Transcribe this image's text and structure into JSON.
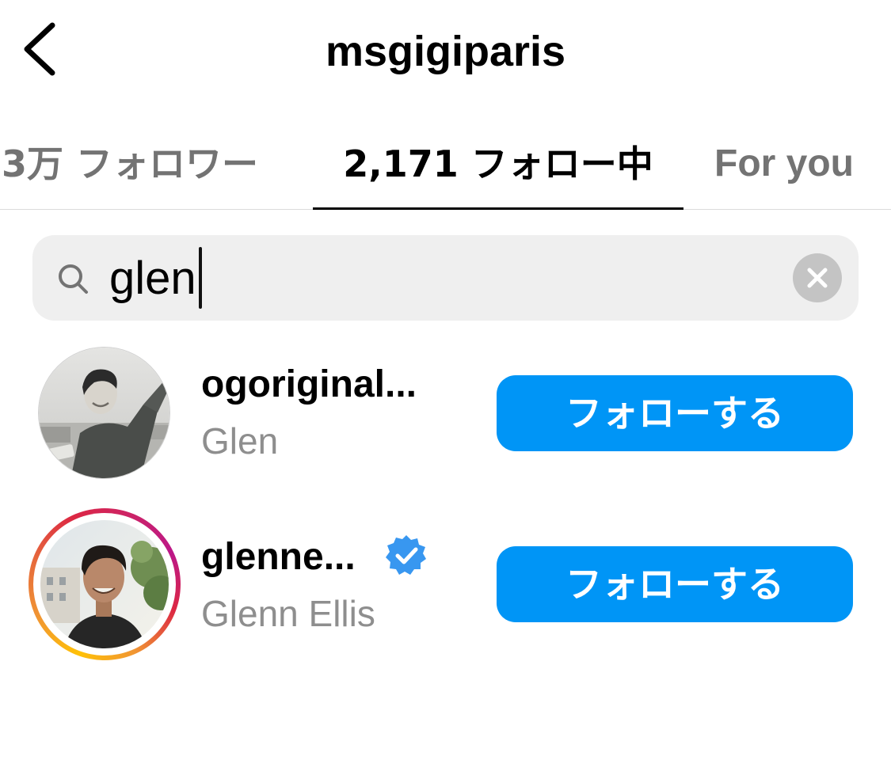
{
  "header": {
    "title": "msgigiparis",
    "back_icon": "chevron-left-icon"
  },
  "tabs": [
    {
      "label": "3万 フォロワー",
      "active": false
    },
    {
      "label": "2,171 フォロー中",
      "active": true
    },
    {
      "label": "For you",
      "active": false
    }
  ],
  "search": {
    "value": "glen",
    "search_icon": "search-icon",
    "clear_icon": "clear-icon"
  },
  "results": [
    {
      "username": "ogoriginal...",
      "full_name": "Glen",
      "verified": false,
      "has_story": false,
      "button_label": "フォローする"
    },
    {
      "username": "glenne...",
      "full_name": "Glenn Ellis",
      "verified": true,
      "has_story": true,
      "button_label": "フォローする"
    }
  ],
  "colors": {
    "accent": "#0095f6",
    "verified": "#3897f0",
    "secondary_text": "#8e8e8e",
    "search_bg": "#efefef"
  }
}
